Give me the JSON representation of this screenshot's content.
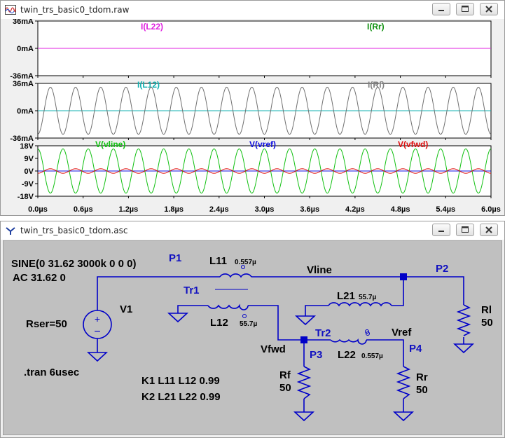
{
  "waveform_window": {
    "title": "twin_trs_basic0_tdom.raw",
    "panes": [
      {
        "traces": [
          {
            "label": "I(L22)",
            "color": "#e020e0"
          },
          {
            "label": "I(Rr)",
            "color": "#109010"
          }
        ],
        "y_ticks": [
          "36mA",
          "0mA",
          "-36mA"
        ]
      },
      {
        "traces": [
          {
            "label": "I(L12)",
            "color": "#10b0b0"
          },
          {
            "label": "I(Rf)",
            "color": "#808080"
          }
        ],
        "y_ticks": [
          "36mA",
          "0mA",
          "-36mA"
        ]
      },
      {
        "traces": [
          {
            "label": "V(vline)",
            "color": "#10c010"
          },
          {
            "label": "V(vref)",
            "color": "#1010e0"
          },
          {
            "label": "V(vfwd)",
            "color": "#e01010"
          }
        ],
        "y_ticks": [
          "18V",
          "9V",
          "0V",
          "-9V",
          "-18V"
        ]
      }
    ],
    "x_ticks": [
      "0.0µs",
      "0.6µs",
      "1.2µs",
      "1.8µs",
      "2.4µs",
      "3.0µs",
      "3.6µs",
      "4.2µs",
      "4.8µs",
      "5.4µs",
      "6.0µs"
    ]
  },
  "chart_data": [
    {
      "type": "line",
      "x_range_us": [
        0,
        6
      ],
      "ylim_mA": [
        -36,
        36
      ],
      "series": [
        {
          "name": "I(L22)",
          "amplitude_mA": 0
        },
        {
          "name": "I(Rr)",
          "amplitude_mA": 0
        }
      ],
      "frequency_MHz": 3
    },
    {
      "type": "line",
      "x_range_us": [
        0,
        6
      ],
      "ylim_mA": [
        -36,
        36
      ],
      "series": [
        {
          "name": "I(L12)",
          "amplitude_mA": 0
        },
        {
          "name": "I(Rf)",
          "amplitude_mA": 31
        }
      ],
      "frequency_MHz": 3
    },
    {
      "type": "line",
      "x_range_us": [
        0,
        6
      ],
      "ylim_V": [
        -18,
        18
      ],
      "series": [
        {
          "name": "V(vline)",
          "amplitude_V": 15.8
        },
        {
          "name": "V(vref)",
          "amplitude_V": 0
        },
        {
          "name": "V(vfwd)",
          "amplitude_V": 1.6
        }
      ],
      "frequency_MHz": 3
    }
  ],
  "schematic_window": {
    "title": "twin_trs_basic0_tdom.asc",
    "labels": {
      "sine": "SINE(0 31.62 3000k 0 0 0)",
      "ac": "AC 31.62 0",
      "rser": "Rser=50",
      "tran": ".tran 6usec",
      "k1": "K1 L11 L12 0.99",
      "k2": "K2 L21 L22 0.99",
      "v1": "V1",
      "p1": "P1",
      "p2": "P2",
      "p3": "P3",
      "p4": "P4",
      "tr1": "Tr1",
      "tr2": "Tr2",
      "l11": "L11",
      "l11v": "0.557µ",
      "l12": "L12",
      "l12v": "55.7µ",
      "l21": "L21",
      "l21v": "55.7µ",
      "l22": "L22",
      "l22v": "0.557µ",
      "vline": "Vline",
      "vfwd": "Vfwd",
      "vref": "Vref",
      "rl": "Rl",
      "rlv": "50",
      "rf": "Rf",
      "rfv": "50",
      "rr": "Rr",
      "rrv": "50"
    }
  }
}
